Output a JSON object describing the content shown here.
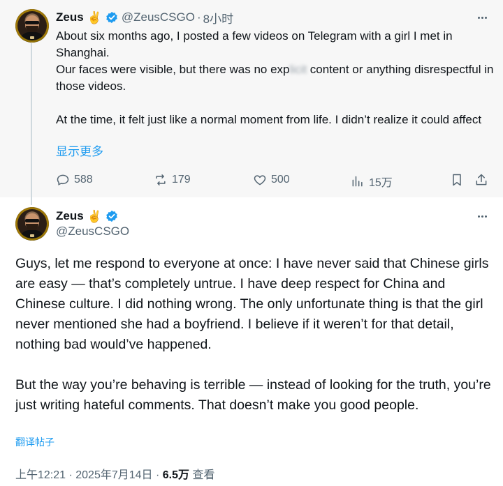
{
  "parent_tweet": {
    "author_name": "Zeus",
    "author_emoji": "✌️",
    "handle": "@ZeusCSGO",
    "separator": "·",
    "time": "8小时",
    "text_line1": "About six months ago, I posted a few videos on Telegram with a girl I met in Shanghai.",
    "text_line2_a": "Our faces were visible, but there was no exp",
    "text_line2_blur": "licit ",
    "text_line2_b": "content or anything disrespectful in those videos.",
    "text_line3": "At the time, it felt just like a normal moment from life. I didn’t realize it could affect",
    "show_more": "显示更多",
    "stats": {
      "replies": "588",
      "reposts": "179",
      "likes": "500",
      "views": "15万"
    },
    "icons": [
      "reply-icon",
      "repost-icon",
      "like-icon",
      "views-icon",
      "bookmark-icon",
      "share-icon",
      "more-icon",
      "verified-icon"
    ]
  },
  "main_tweet": {
    "author_name": "Zeus",
    "author_emoji": "✌️",
    "handle": "@ZeusCSGO",
    "paragraph1": "Guys, let me respond to everyone at once: I have never said that Chinese girls are easy — that’s completely untrue. I have deep respect for China and Chinese culture. I did nothing wrong. The only unfortunate thing is that the girl never mentioned she had a boyfriend. I believe if it weren’t for that detail, nothing bad would’ve happened.",
    "paragraph2": "But the way you’re behaving is terrible — instead of looking for the truth, you’re just writing hateful comments. That doesn’t make you good people.",
    "translate": "翻译帖子",
    "timestamp": "上午12:21 · 2025年7月14日 · ",
    "views_count": "6.5万",
    "views_label": " 查看"
  },
  "colors": {
    "accent": "#1d9bf0",
    "muted": "#536471",
    "text": "#0f1419",
    "parent_bg": "#f7f7f7",
    "thread_line": "#cfd9de"
  }
}
